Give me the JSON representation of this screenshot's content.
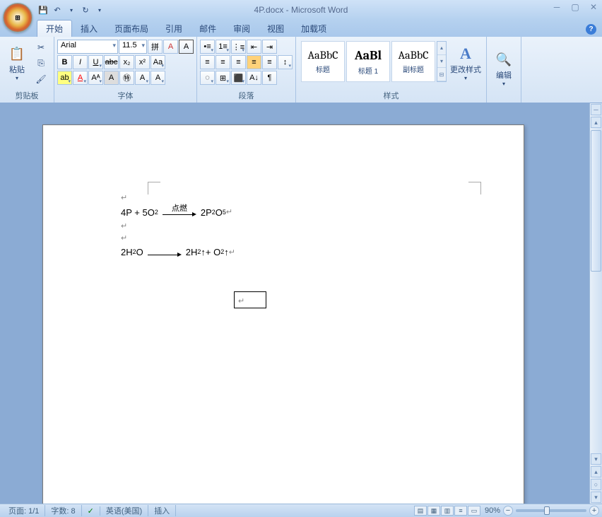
{
  "title": {
    "doc": "4P.docx",
    "sep": " - ",
    "app": "Microsoft Word"
  },
  "qat": {
    "save": "💾",
    "undo": "↶",
    "redo": "↻",
    "more": "▾"
  },
  "winctl": {
    "min": "─",
    "max": "▢",
    "close": "✕"
  },
  "tabs": {
    "home": "开始",
    "insert": "插入",
    "layout": "页面布局",
    "ref": "引用",
    "mail": "邮件",
    "review": "审阅",
    "view": "视图",
    "addin": "加载项"
  },
  "help": "?",
  "clipboard": {
    "paste": "粘贴",
    "label": "剪贴板",
    "cut": "✂",
    "copy": "⎘",
    "painter": "🖌"
  },
  "font": {
    "name": "Arial",
    "size": "11.5",
    "pinyin": "拼",
    "charborder": "A",
    "clear": "A",
    "bold": "B",
    "italic": "I",
    "underline": "U",
    "strike": "abc",
    "sub": "x₂",
    "sup": "x²",
    "case": "Aa",
    "hilite": "ab",
    "color": "A",
    "grow": "Aᴬ",
    "shrink": "Aₐ",
    "charshade": "A",
    "enclosed": "㊕",
    "bigA": "A",
    "dropA": "A",
    "label": "字体"
  },
  "para": {
    "bullets": "≡",
    "numbers": "≡",
    "multi": "≡",
    "indentL": "⇤",
    "indentR": "⇥",
    "alignL": "≡",
    "alignC": "≡",
    "alignR": "≡",
    "justify": "≡",
    "dist": "≡",
    "lh": "↕",
    "shade": "▦",
    "border": "▢",
    "sort": "A↓",
    "marks": "¶",
    "bg": "⬛",
    "borders": "⊞",
    "label": "段落"
  },
  "styles": {
    "items": [
      {
        "prev": "AaBbC",
        "name": "标题"
      },
      {
        "prev": "AaBl",
        "name": "标题 1"
      },
      {
        "prev": "AaBbC",
        "name": "副标题"
      }
    ],
    "up": "▴",
    "down": "▾",
    "more": "⊟",
    "change": "更改样式",
    "label": "样式"
  },
  "editing": {
    "label": "编辑"
  },
  "doc": {
    "line1_left": "4P + 5O",
    "line1_sub": "2",
    "line1_arrow": "点燃",
    "line1_right": "2P",
    "line1_r2": "2",
    "line1_r3": "O",
    "line1_r4": "5",
    "line2_left": "2H",
    "line2_s1": "2",
    "line2_o": "O",
    "line2_right": "2H",
    "line2_r2": "2",
    "line2_up": "↑+ O",
    "line2_r3": "2",
    "line2_up2": " ↑"
  },
  "status": {
    "page": "页面: 1/1",
    "words": "字数: 8",
    "check": "✓",
    "lang": "英语(美国)",
    "mode": "插入",
    "zoom": "90%"
  }
}
